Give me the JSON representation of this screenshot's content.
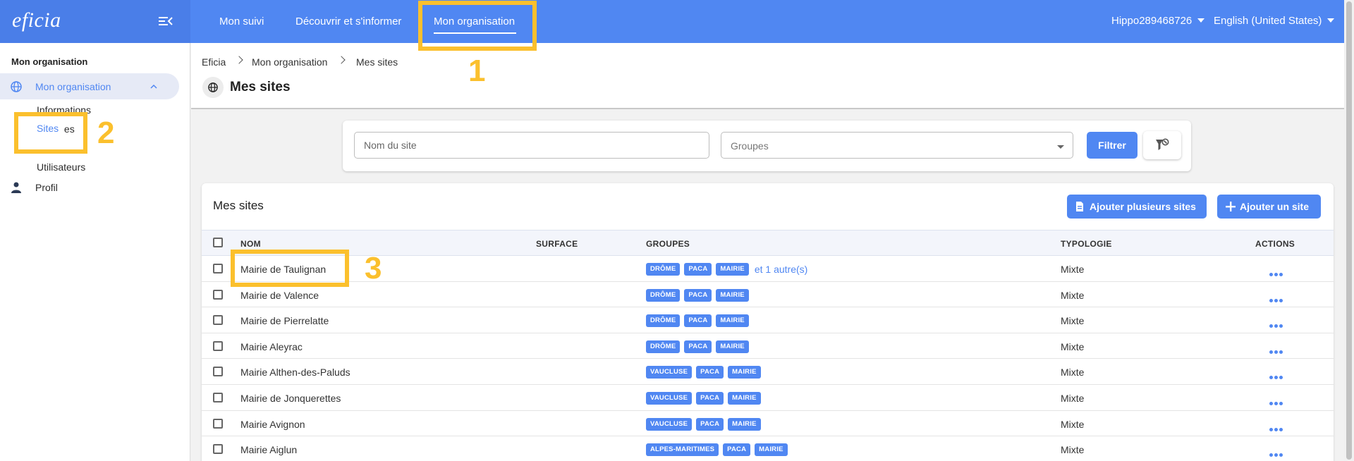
{
  "app": {
    "logo": "eficia"
  },
  "topnav": {
    "items": [
      "Mon suivi",
      "Découvrir et s'informer",
      "Mon organisation"
    ],
    "user": "Hippo289468726",
    "language": "English (United States)"
  },
  "sidebar": {
    "section_title": "Mon organisation",
    "active_item": "Mon organisation",
    "sub_items": [
      "Informations",
      "Sites",
      "Groupes",
      "Utilisateurs"
    ],
    "profile": "Profil"
  },
  "breadcrumb": [
    "Eficia",
    "Mon organisation",
    "Mes sites"
  ],
  "page": {
    "title": "Mes sites"
  },
  "filters": {
    "name_placeholder": "Nom du site",
    "groups_placeholder": "Groupes",
    "filter_button": "Filtrer"
  },
  "card": {
    "title": "Mes sites",
    "add_many": "Ajouter plusieurs sites",
    "add_one": "Ajouter un site"
  },
  "table": {
    "columns": [
      "NOM",
      "SURFACE",
      "GROUPES",
      "TYPOLOGIE",
      "ACTIONS"
    ],
    "rows": [
      {
        "name": "Mairie de Taulignan",
        "tags": [
          "DRÔME",
          "PACA",
          "MAIRIE"
        ],
        "more": "et 1 autre(s)",
        "type": "Mixte"
      },
      {
        "name": "Mairie de Valence",
        "tags": [
          "DRÔME",
          "PACA",
          "MAIRIE"
        ],
        "more": "",
        "type": "Mixte"
      },
      {
        "name": "Mairie de Pierrelatte",
        "tags": [
          "DRÔME",
          "PACA",
          "MAIRIE"
        ],
        "more": "",
        "type": "Mixte"
      },
      {
        "name": "Mairie Aleyrac",
        "tags": [
          "DRÔME",
          "PACA",
          "MAIRIE"
        ],
        "more": "",
        "type": "Mixte"
      },
      {
        "name": "Mairie Althen-des-Paluds",
        "tags": [
          "VAUCLUSE",
          "PACA",
          "MAIRIE"
        ],
        "more": "",
        "type": "Mixte"
      },
      {
        "name": "Mairie de Jonquerettes",
        "tags": [
          "VAUCLUSE",
          "PACA",
          "MAIRIE"
        ],
        "more": "",
        "type": "Mixte"
      },
      {
        "name": "Mairie Avignon",
        "tags": [
          "VAUCLUSE",
          "PACA",
          "MAIRIE"
        ],
        "more": "",
        "type": "Mixte"
      },
      {
        "name": "Mairie Aiglun",
        "tags": [
          "ALPES-MARITIMES",
          "PACA",
          "MAIRIE"
        ],
        "more": "",
        "type": "Mixte"
      }
    ]
  },
  "annotations": [
    "1",
    "2",
    "3"
  ],
  "colors": {
    "primary": "#5087f2",
    "highlight": "#fbc02d"
  }
}
